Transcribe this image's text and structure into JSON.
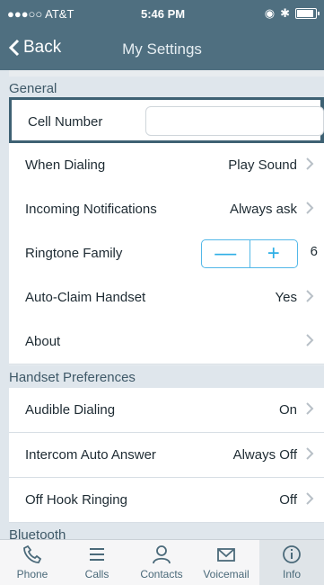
{
  "status": {
    "carrier": "●●●○○ AT&T",
    "time": "5:46 PM"
  },
  "nav": {
    "back_label": "Back",
    "title": "My Settings"
  },
  "sections": {
    "general": "General",
    "handset": "Handset Preferences",
    "bluetooth": "Bluetooth"
  },
  "rows": {
    "cell_number": "Cell Number",
    "when_dialing": {
      "label": "When Dialing",
      "value": "Play Sound"
    },
    "incoming": {
      "label": "Incoming Notifications",
      "value": "Always ask"
    },
    "ringtone": {
      "label": "Ringtone Family",
      "value": "6",
      "minus": "—",
      "plus": "+"
    },
    "auto_claim": {
      "label": "Auto-Claim Handset",
      "value": "Yes"
    },
    "about": {
      "label": "About",
      "value": ""
    },
    "audible": {
      "label": "Audible Dialing",
      "value": "On"
    },
    "intercom": {
      "label": "Intercom Auto Answer",
      "value": "Always Off"
    },
    "off_hook": {
      "label": "Off Hook Ringing",
      "value": "Off"
    }
  },
  "tabs": {
    "phone": "Phone",
    "calls": "Calls",
    "contacts": "Contacts",
    "voicemail": "Voicemail",
    "info": "Info"
  },
  "colors": {
    "nav": "#4f6f80",
    "accent": "#2daee5",
    "section": "#dfe6ec"
  }
}
